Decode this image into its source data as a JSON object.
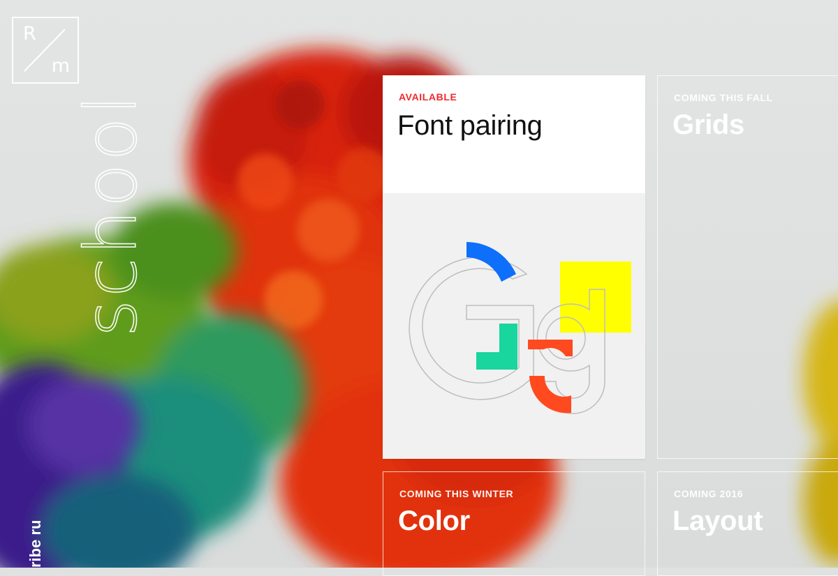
{
  "brand": {
    "logo_letter_top": "R",
    "logo_letter_bottom": "m",
    "vertical_title": "school",
    "domain_text": "ribe ru"
  },
  "courses": [
    {
      "status": "AVAILABLE",
      "title": "Font pairing",
      "status_color": "#ef2a2d",
      "preview": "Gg"
    },
    {
      "status": "COMING THIS FALL",
      "title": "Grids"
    },
    {
      "status": "COMING THIS WINTER",
      "title": "Color"
    },
    {
      "status": "COMING 2016",
      "title": "Layout"
    }
  ],
  "colors": {
    "card_active_bg": "#f1f1f1",
    "accent_blue": "#0d6ffa",
    "accent_green": "#19d59e",
    "accent_orange": "#ff4a1f",
    "accent_yellow": "#ffff00"
  }
}
